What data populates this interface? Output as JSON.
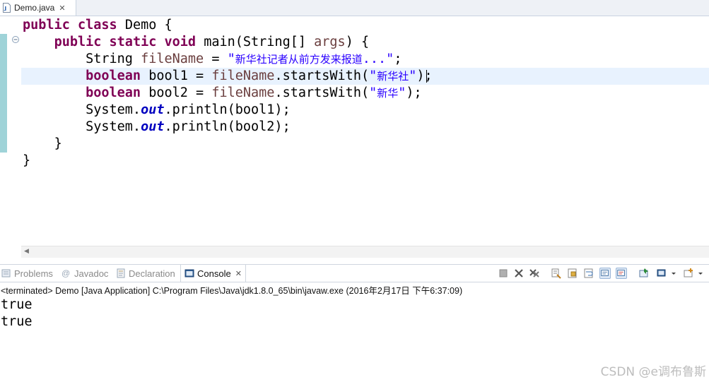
{
  "editor": {
    "tab_label": "Demo.java",
    "tab_close": "✕",
    "code": {
      "l1_kw1": "public",
      "l1_kw2": "class",
      "l1_rest": "Demo {",
      "l2_kw1": "public",
      "l2_kw2": "static",
      "l2_kw3": "void",
      "l2_a": "main(String[] ",
      "l2_var": "args",
      "l2_b": ") {",
      "l3_type": "String ",
      "l3_var": "fileName",
      "l3_eq": " = ",
      "l3_q1": "\"",
      "l3_cjk": "新华社记者从前方发来报道",
      "l3_q2": "...\"",
      "l3_end": ";",
      "l4_kw": "boolean",
      "l4_a": " bool1 = ",
      "l4_var": "fileName",
      "l4_b": ".startsWith(",
      "l4_q1": "\"",
      "l4_cjk": "新华社",
      "l4_q2": "\"",
      "l4_end": ");",
      "l5_kw": "boolean",
      "l5_a": " bool2 = ",
      "l5_var": "fileName",
      "l5_b": ".startsWith(",
      "l5_q1": "\"",
      "l5_cjk": "新华",
      "l5_q2": "\"",
      "l5_end": ");",
      "l6_a": "System.",
      "l6_fld": "out",
      "l6_b": ".println(bool1);",
      "l7_a": "System.",
      "l7_fld": "out",
      "l7_b": ".println(bool2);",
      "l8": "}",
      "l9": "}"
    },
    "scroll_arrow": "◀"
  },
  "views": {
    "tabs": [
      "Problems",
      "Javadoc",
      "Declaration",
      "Console"
    ],
    "active_tab_close": "✕",
    "status": "<terminated> Demo [Java Application] C:\\Program Files\\Java\\jdk1.8.0_65\\bin\\javaw.exe (2016年2月17日 下午6:37:09)",
    "output": [
      "true",
      "true"
    ]
  },
  "watermark": "CSDN @e调布鲁斯",
  "colors": {
    "keyword": "#7f0055",
    "string": "#2a00ff",
    "field": "#0000c0",
    "local_var": "#6a3e3e",
    "gutter": "#9fd3d8"
  }
}
